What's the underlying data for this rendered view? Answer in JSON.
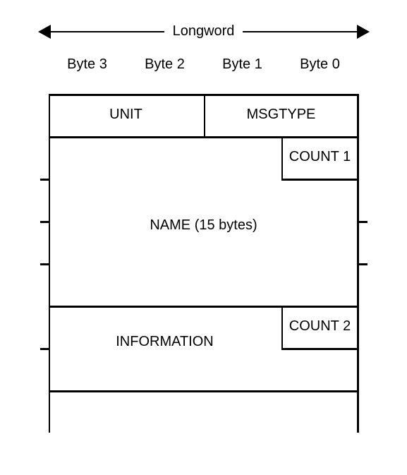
{
  "header": {
    "longword": "Longword",
    "bytes": [
      "Byte 3",
      "Byte 2",
      "Byte 1",
      "Byte 0"
    ]
  },
  "fields": {
    "unit": "UNIT",
    "msgtype": "MSGTYPE",
    "count1": "COUNT 1",
    "name": "NAME (15 bytes)",
    "count2": "COUNT 2",
    "information": "INFORMATION"
  }
}
